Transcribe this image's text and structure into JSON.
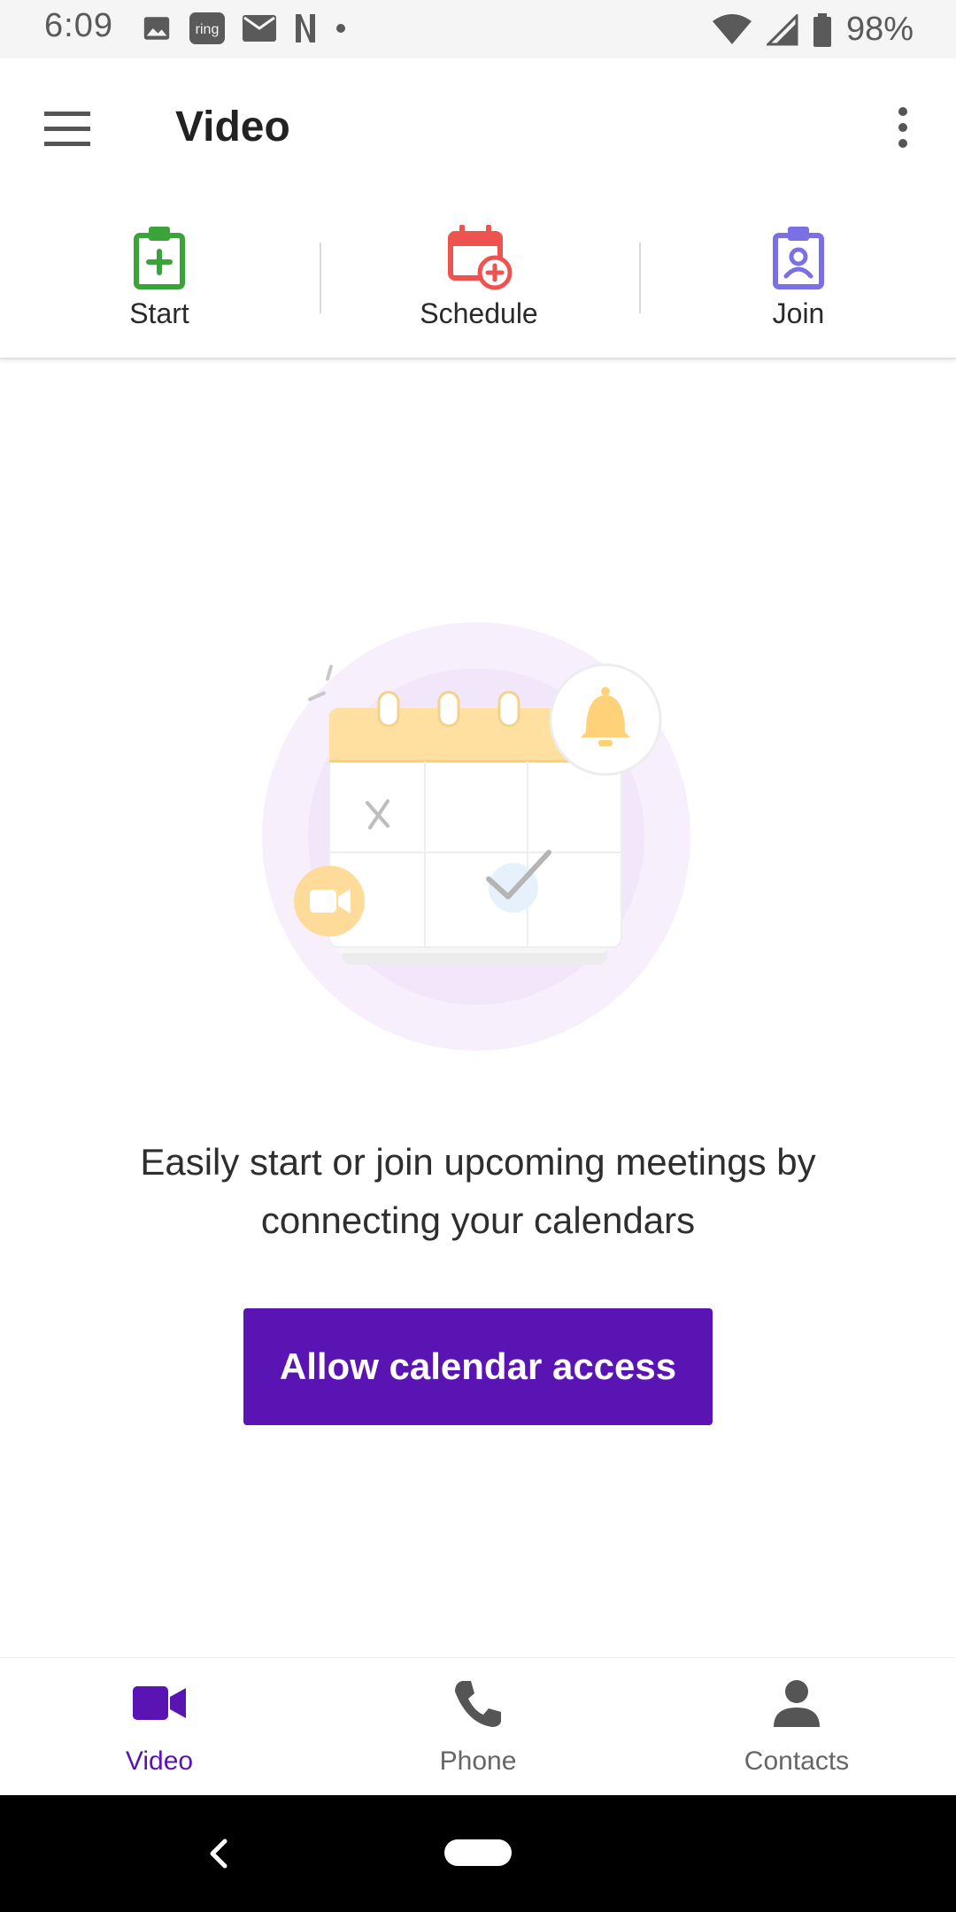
{
  "status_bar": {
    "time": "6:09",
    "notification_icons": [
      "image-icon",
      "ring-icon",
      "mail-icon",
      "netflix-icon",
      "dot-icon"
    ],
    "ring_label": "ring",
    "netflix_label": "N",
    "battery": "98%"
  },
  "app_bar": {
    "title": "Video"
  },
  "actions": [
    {
      "label": "Start",
      "icon": "clipboard-plus-icon",
      "color": "#3aa43a"
    },
    {
      "label": "Schedule",
      "icon": "calendar-add-icon",
      "color": "#ef5350"
    },
    {
      "label": "Join",
      "icon": "clipboard-person-icon",
      "color": "#7b6fe6"
    }
  ],
  "empty_state": {
    "message": "Easily start or join upcoming meetings by connecting your calendars",
    "button_label": "Allow calendar access",
    "button_color": "#5a14b4"
  },
  "bottom_nav": [
    {
      "label": "Video",
      "icon": "video-icon",
      "active": true
    },
    {
      "label": "Phone",
      "icon": "phone-icon",
      "active": false
    },
    {
      "label": "Contacts",
      "icon": "person-icon",
      "active": false
    }
  ]
}
